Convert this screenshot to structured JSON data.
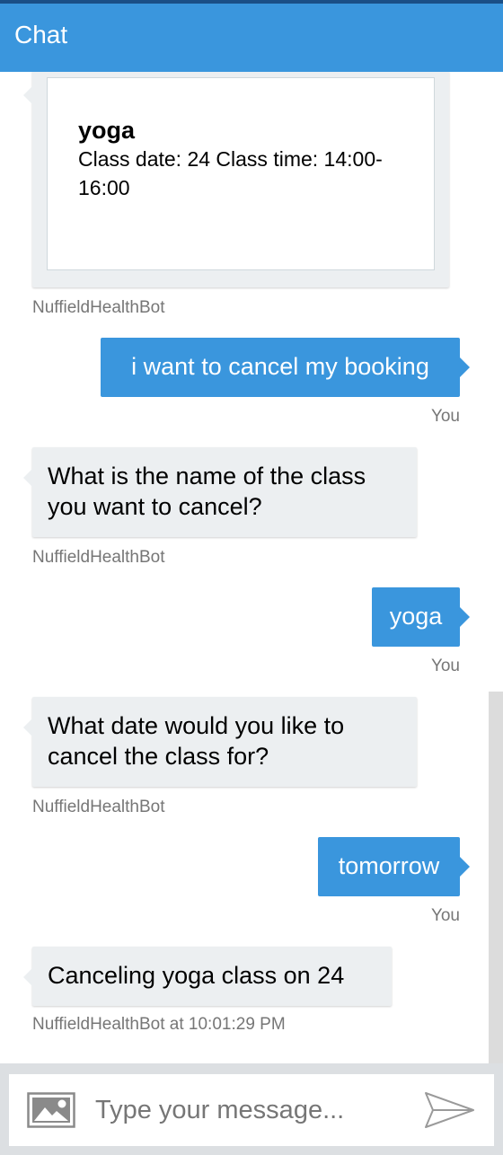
{
  "header": {
    "title": "Chat"
  },
  "card": {
    "title": "yoga",
    "subtitle": "Class date: 24 Class time: 14:00-16:00",
    "sender": "NuffieldHealthBot"
  },
  "messages": [
    {
      "from": "user",
      "text": "i want to cancel my booking",
      "sender": "You"
    },
    {
      "from": "bot",
      "text": "What is the name of the class you want to cancel?",
      "sender": "NuffieldHealthBot"
    },
    {
      "from": "user",
      "text": "yoga",
      "sender": "You"
    },
    {
      "from": "bot",
      "text": "What date would you like to cancel the class for?",
      "sender": "NuffieldHealthBot"
    },
    {
      "from": "user",
      "text": "tomorrow",
      "sender": "You"
    },
    {
      "from": "bot",
      "text": "Canceling yoga class on 24",
      "sender": "NuffieldHealthBot at 10:01:29 PM"
    }
  ],
  "input": {
    "placeholder": "Type your message..."
  },
  "icons": {
    "upload": "image-icon",
    "send": "send-icon"
  },
  "colors": {
    "header": "#3a96dd",
    "user_bubble": "#3a96dd",
    "bot_bubble": "#eceff1"
  }
}
